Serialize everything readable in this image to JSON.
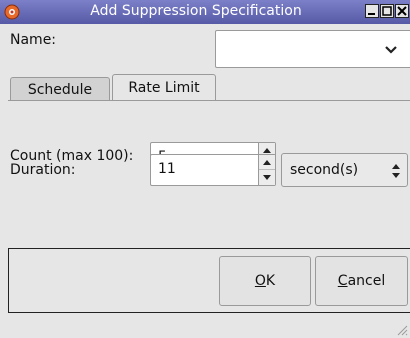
{
  "window": {
    "title": "Add Suppression Specification",
    "buttons": {
      "minimize": "_",
      "maximize": "□",
      "close": "X"
    }
  },
  "name_field": {
    "label": "Name:",
    "value": ""
  },
  "tabs": [
    {
      "label": "Schedule",
      "active": false
    },
    {
      "label": "Rate Limit",
      "active": true
    }
  ],
  "rate_limit": {
    "count": {
      "label": "Count (max 100):",
      "value": "5"
    },
    "duration": {
      "label": "Duration:",
      "value": "11",
      "unit": "second(s)"
    }
  },
  "footer": {
    "ok_prefix": "",
    "ok_mnemonic": "O",
    "ok_rest": "K",
    "cancel_mnemonic": "C",
    "cancel_rest": "ancel"
  },
  "colors": {
    "title_bar": "#6a6eb8",
    "window_bg": "#e6e6e6"
  }
}
